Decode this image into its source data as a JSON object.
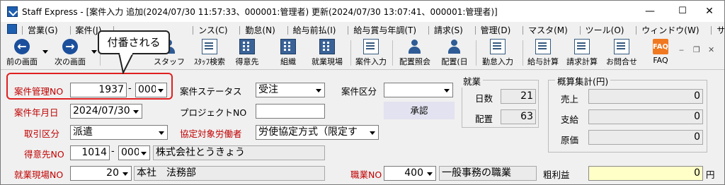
{
  "window": {
    "title": "Staff Express - [案件入力  追加(2024/07/30 11:57:33、000001:管理者) 更新(2024/07/30 13:07:41、000001:管理者)]",
    "minimize": "—",
    "maximize": "☐",
    "close": "✕"
  },
  "menu": {
    "items": [
      "営業(G)",
      "案件(J)",
      "",
      "ンス(C)",
      "勤怠(N)",
      "給与前払(I)",
      "給与賞与年調(T)",
      "請求(S)",
      "管理(D)",
      "マスタ(M)",
      "ツール(O)",
      "ウィンドウ(W)",
      "サポート(H)"
    ],
    "mdi_min": "‒",
    "mdi_restore": "❐",
    "mdi_close": "✕"
  },
  "toolbar": {
    "prev": "前の画面",
    "next": "次の画面",
    "staff": "スタッフ",
    "staff_search": "ｽﾀｯﾌ検索",
    "client": "得意先",
    "org": "組織",
    "site": "就業現場",
    "case_input": "案件入力",
    "placement_inquiry": "配置照会",
    "placement_day": "配置(日",
    "attendance_input": "勤怠入力",
    "payroll_calc": "給与計算",
    "billing_calc": "請求計算",
    "contact": "お問合せ",
    "faq": "FAQ",
    "faq_icon_text": "FAQ"
  },
  "callout": {
    "text": "付番される"
  },
  "form": {
    "case_no_label": "案件管理NO",
    "case_no_value": "1937",
    "case_no_sub": "000",
    "status_label": "案件ステータス",
    "status_value": "受注",
    "category_label": "案件区分",
    "category_value": "",
    "approve_button": "承認",
    "date_label": "案件年月日",
    "date_value": "2024/07/30",
    "project_label": "プロジェクトNO",
    "project_value": "",
    "deal_type_label": "取引区分",
    "deal_type_value": "派遣",
    "agreement_label": "協定対象労働者",
    "agreement_value": "労使協定方式（限定す",
    "client_label": "得意先NO",
    "client_no": "1014",
    "client_sub": "000",
    "client_name": "株式会社とうきょう",
    "site_label": "就業現場NO",
    "site_no": "20",
    "site_name": "本社　法務部",
    "job_label": "職業NO",
    "job_no": "400",
    "job_name": "一般事務の職業",
    "gross_profit_label": "粗利益",
    "gross_profit_value": "0",
    "gross_profit_unit": "円"
  },
  "employment": {
    "title": "就業",
    "days_label": "日数",
    "days_value": "21",
    "placement_label": "配置",
    "placement_value": "63"
  },
  "summary": {
    "title": "概算集計(円)",
    "sales_label": "売上",
    "sales_value": "0",
    "pay_label": "支給",
    "pay_value": "0",
    "cost_label": "原価",
    "cost_value": "0"
  }
}
